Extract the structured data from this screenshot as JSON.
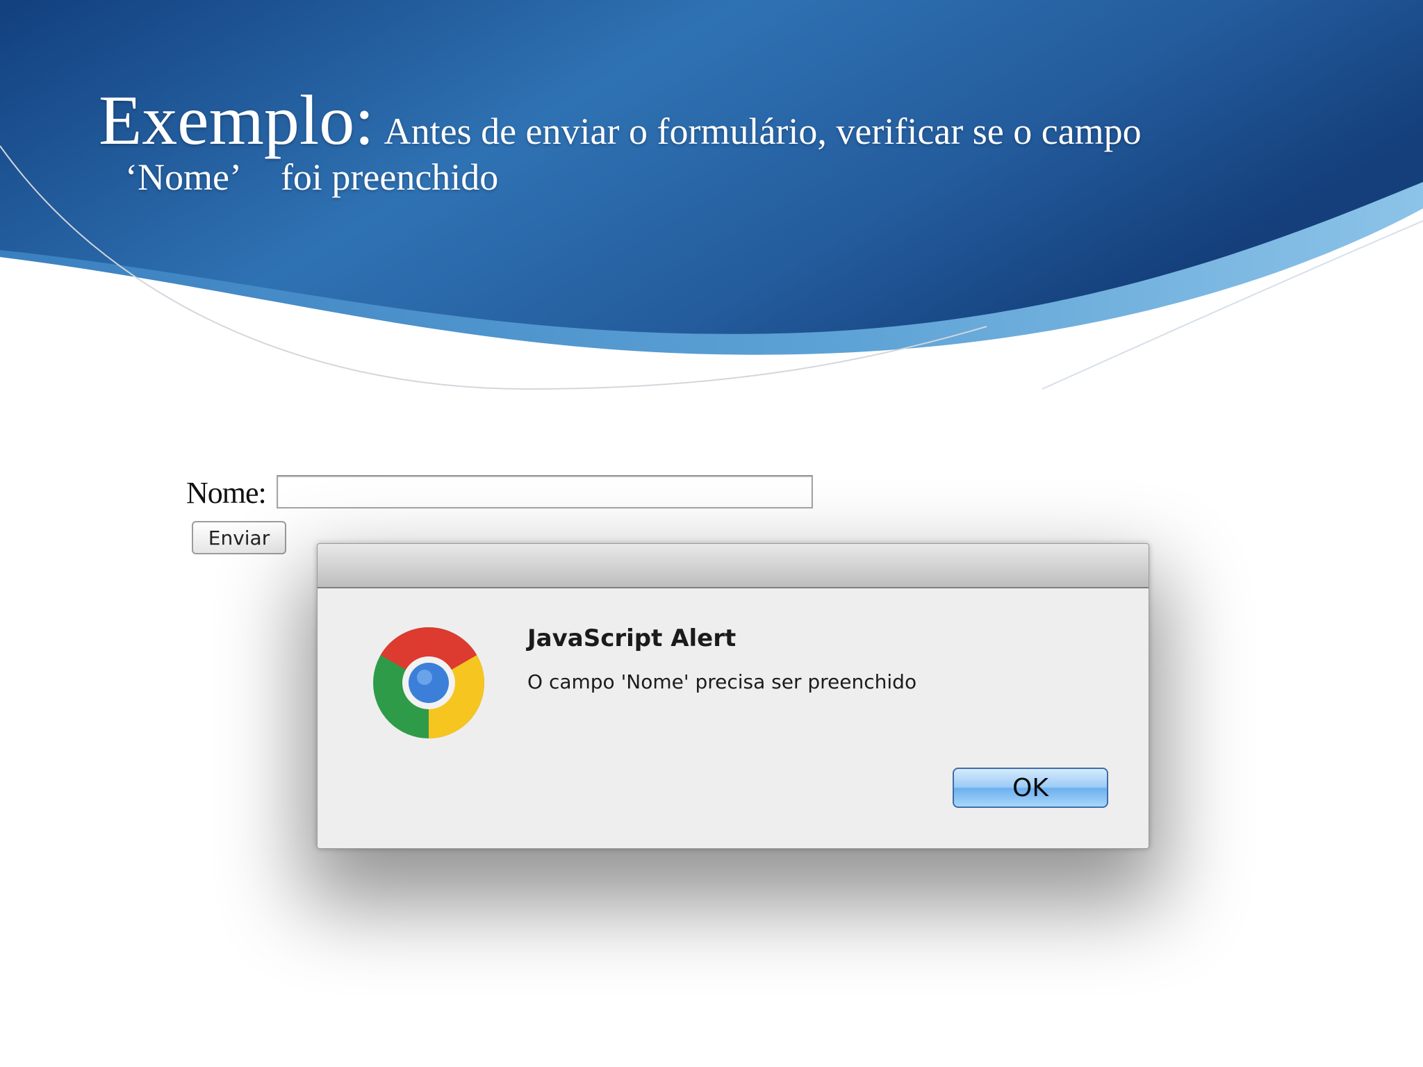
{
  "slide": {
    "title_main": "Exemplo:",
    "title_sub": "Antes de enviar o formulário, verificar se o campo",
    "title_quoted": "‘Nome’",
    "title_rest": "foi preenchido"
  },
  "form": {
    "name_label": "Nome:",
    "name_value": "",
    "submit_label": "Enviar"
  },
  "alert": {
    "title": "JavaScript Alert",
    "message": "O campo 'Nome' precisa ser preenchido",
    "ok_label": "OK",
    "icon": "chrome-logo-icon"
  },
  "colors": {
    "header_dark": "#174a8c",
    "header_light": "#3f86c4",
    "ok_button": "#9ccbf5",
    "dialog_bg": "#efeeef"
  }
}
